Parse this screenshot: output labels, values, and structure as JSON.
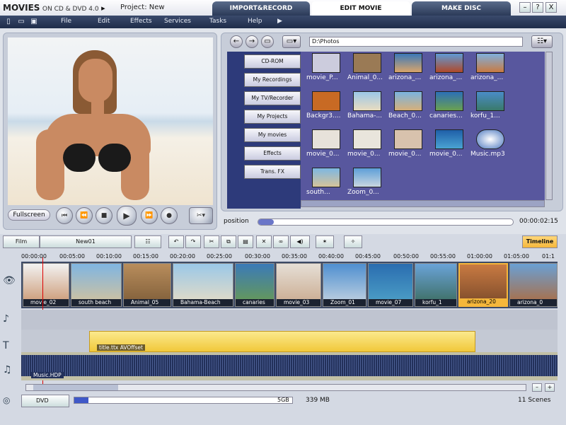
{
  "app": {
    "name": "MOVIES",
    "subtitle": "ON CD & DVD 4.0",
    "project": "Project: New"
  },
  "tabs": [
    "IMPORT&RECORD",
    "EDIT MOVIE",
    "MAKE DISC"
  ],
  "window_buttons": [
    "?",
    "X"
  ],
  "menu": [
    "File",
    "Edit",
    "Effects",
    "Services",
    "Tasks",
    "Help"
  ],
  "preview": {
    "fullscreen": "Fullscreen"
  },
  "browser": {
    "path": "D:\\Photos",
    "categories": [
      "CD-ROM",
      "My Recordings",
      "My TV/Recorder",
      "My Projects",
      "My movies",
      "Effects",
      "Trans. FX"
    ],
    "items": [
      "movie_P...",
      "Animal_0...",
      "arizona_...",
      "arizona_...",
      "arizona_...",
      "Backgr3....",
      "Bahama-...",
      "Beach_0...",
      "canaries...",
      "korfu_1...",
      "movie_0...",
      "movie_0...",
      "movie_0...",
      "movie_0...",
      "Music.mp3",
      "south...",
      "Zoom_0..."
    ]
  },
  "position": {
    "label": "position",
    "time": "00:00:02:15"
  },
  "timeline": {
    "mode": "Film",
    "name": "New01",
    "toggle": "Timeline",
    "ruler": [
      "00:00:00",
      "00:05:00",
      "00:10:00",
      "00:15:00",
      "00:20:00",
      "00:25:00",
      "00:30:00",
      "00:35:00",
      "00:40:00",
      "00:45:00",
      "00:50:00",
      "00:55:00",
      "01:00:00",
      "01:05:00",
      "01:1"
    ],
    "clips": [
      "movie_02",
      "south beach",
      "Animal_05",
      "Bahama-Beach",
      "canaries",
      "movie_03",
      "Zoom_01",
      "movie_07",
      "korfu_1",
      "arizona_20",
      "arizona_0"
    ],
    "title_clip": "title.ttx AVOffset",
    "audio_clip": "Music.HDP"
  },
  "status": {
    "format": "DVD",
    "size": "5GB",
    "used": "339 MB",
    "scenes": "11 Scenes"
  },
  "colors": {
    "accent": "#f5b73b",
    "nav": "#1f2d4a",
    "browser_bg": "#58579e"
  }
}
